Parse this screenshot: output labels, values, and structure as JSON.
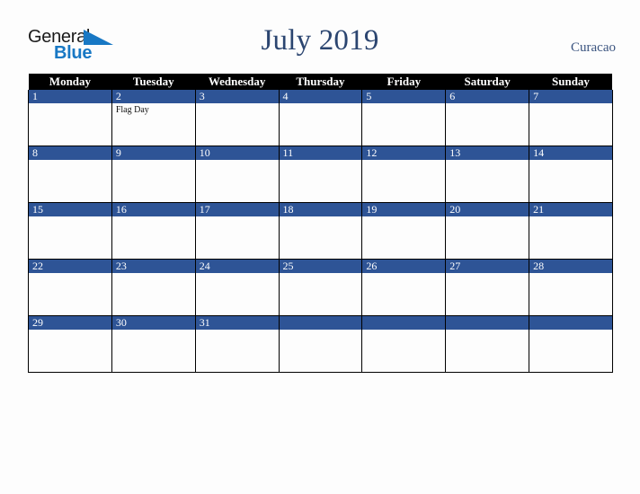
{
  "branding": {
    "logo_word_1": "General",
    "logo_word_2": "Blue",
    "logo_triangle_color": "#1878c4",
    "logo_word_1_color": "#1a1a1a",
    "logo_word_2_color": "#1878c4"
  },
  "header": {
    "title": "July 2019",
    "locale": "Curacao",
    "title_color": "#2b4570",
    "locale_color": "#3c5580"
  },
  "calendar": {
    "month": "July",
    "year": "2019",
    "weekday_headers": [
      "Monday",
      "Tuesday",
      "Wednesday",
      "Thursday",
      "Friday",
      "Saturday",
      "Sunday"
    ],
    "header_bg_color": "#000000",
    "header_text_color": "#ffffff",
    "day_band_color": "#2e5496",
    "day_number_color": "#ffffff",
    "grid_line_color": "#000000",
    "cell_bg_color": "#fdfdfd",
    "weeks": [
      [
        {
          "number": "1",
          "events": []
        },
        {
          "number": "2",
          "events": [
            "Flag Day"
          ]
        },
        {
          "number": "3",
          "events": []
        },
        {
          "number": "4",
          "events": []
        },
        {
          "number": "5",
          "events": []
        },
        {
          "number": "6",
          "events": []
        },
        {
          "number": "7",
          "events": []
        }
      ],
      [
        {
          "number": "8",
          "events": []
        },
        {
          "number": "9",
          "events": []
        },
        {
          "number": "10",
          "events": []
        },
        {
          "number": "11",
          "events": []
        },
        {
          "number": "12",
          "events": []
        },
        {
          "number": "13",
          "events": []
        },
        {
          "number": "14",
          "events": []
        }
      ],
      [
        {
          "number": "15",
          "events": []
        },
        {
          "number": "16",
          "events": []
        },
        {
          "number": "17",
          "events": []
        },
        {
          "number": "18",
          "events": []
        },
        {
          "number": "19",
          "events": []
        },
        {
          "number": "20",
          "events": []
        },
        {
          "number": "21",
          "events": []
        }
      ],
      [
        {
          "number": "22",
          "events": []
        },
        {
          "number": "23",
          "events": []
        },
        {
          "number": "24",
          "events": []
        },
        {
          "number": "25",
          "events": []
        },
        {
          "number": "26",
          "events": []
        },
        {
          "number": "27",
          "events": []
        },
        {
          "number": "28",
          "events": []
        }
      ],
      [
        {
          "number": "29",
          "events": []
        },
        {
          "number": "30",
          "events": []
        },
        {
          "number": "31",
          "events": []
        },
        {
          "number": "",
          "events": []
        },
        {
          "number": "",
          "events": []
        },
        {
          "number": "",
          "events": []
        },
        {
          "number": "",
          "events": []
        }
      ]
    ]
  }
}
